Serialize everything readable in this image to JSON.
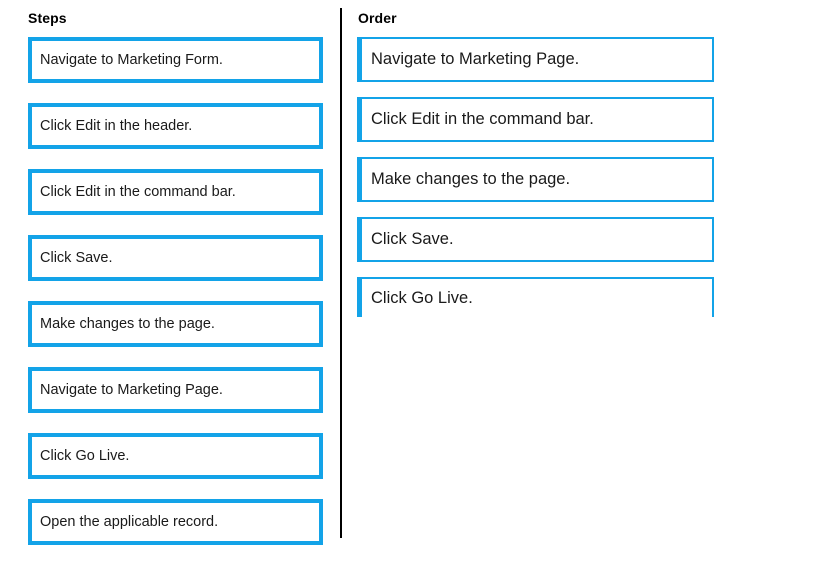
{
  "columns": {
    "source": {
      "header": "Steps",
      "items": [
        {
          "label": "Navigate to Marketing Form."
        },
        {
          "label": "Click Edit in the header."
        },
        {
          "label": "Click Edit in the command bar."
        },
        {
          "label": "Click Save."
        },
        {
          "label": "Make changes to the page."
        },
        {
          "label": "Navigate to Marketing Page."
        },
        {
          "label": "Click Go Live."
        },
        {
          "label": "Open the applicable record."
        }
      ]
    },
    "target": {
      "header": "Order",
      "items": [
        {
          "label": "Navigate to Marketing Page."
        },
        {
          "label": "Click Edit in the command bar."
        },
        {
          "label": "Make changes to the page."
        },
        {
          "label": "Click Save."
        },
        {
          "label": "Click Go Live."
        }
      ]
    }
  },
  "colors": {
    "tile_border": "#13A3E8",
    "divider": "#000000",
    "text": "#1a1a1a",
    "background": "#ffffff"
  }
}
